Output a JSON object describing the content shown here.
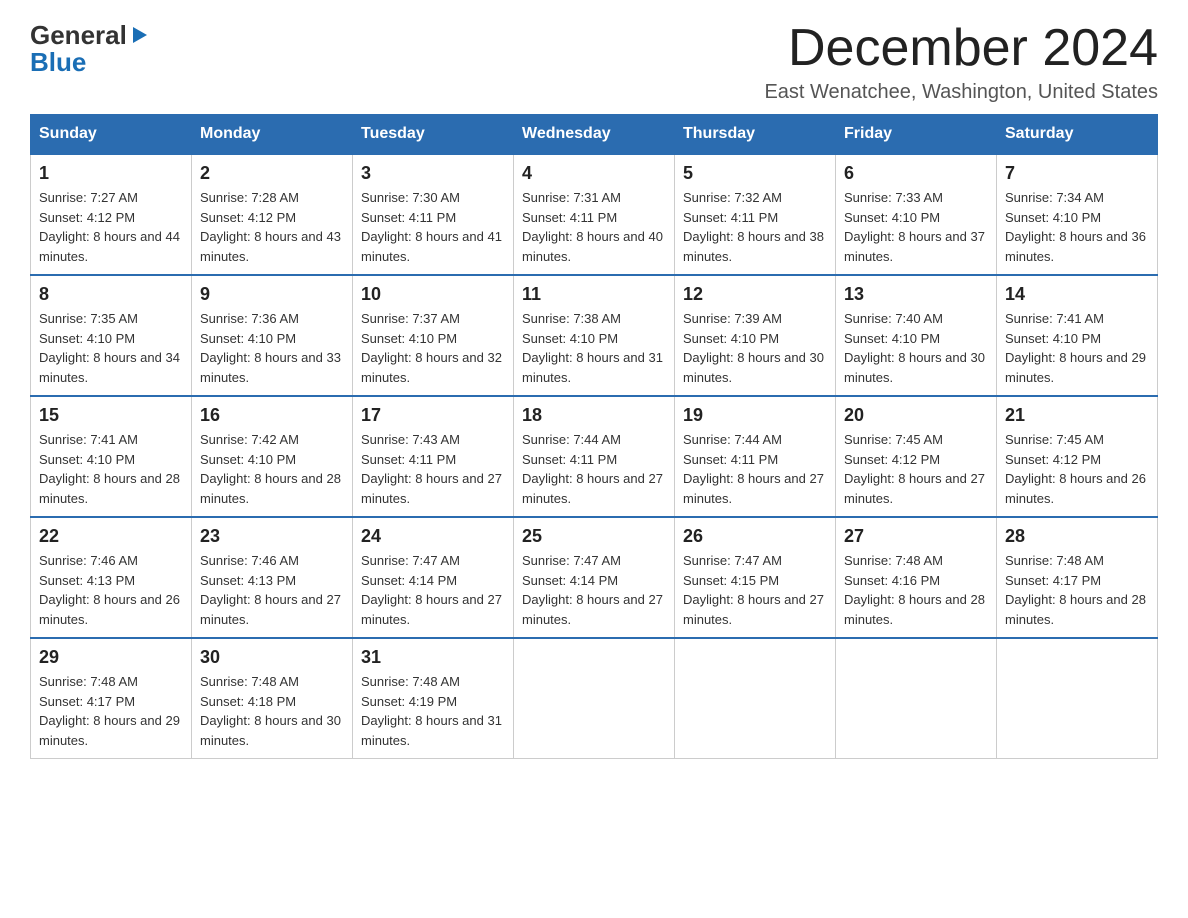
{
  "logo": {
    "line1": "General",
    "line2": "Blue",
    "arrow": "▶"
  },
  "title": "December 2024",
  "subtitle": "East Wenatchee, Washington, United States",
  "weekdays": [
    "Sunday",
    "Monday",
    "Tuesday",
    "Wednesday",
    "Thursday",
    "Friday",
    "Saturday"
  ],
  "weeks": [
    [
      {
        "day": "1",
        "sunrise": "7:27 AM",
        "sunset": "4:12 PM",
        "daylight": "8 hours and 44 minutes."
      },
      {
        "day": "2",
        "sunrise": "7:28 AM",
        "sunset": "4:12 PM",
        "daylight": "8 hours and 43 minutes."
      },
      {
        "day": "3",
        "sunrise": "7:30 AM",
        "sunset": "4:11 PM",
        "daylight": "8 hours and 41 minutes."
      },
      {
        "day": "4",
        "sunrise": "7:31 AM",
        "sunset": "4:11 PM",
        "daylight": "8 hours and 40 minutes."
      },
      {
        "day": "5",
        "sunrise": "7:32 AM",
        "sunset": "4:11 PM",
        "daylight": "8 hours and 38 minutes."
      },
      {
        "day": "6",
        "sunrise": "7:33 AM",
        "sunset": "4:10 PM",
        "daylight": "8 hours and 37 minutes."
      },
      {
        "day": "7",
        "sunrise": "7:34 AM",
        "sunset": "4:10 PM",
        "daylight": "8 hours and 36 minutes."
      }
    ],
    [
      {
        "day": "8",
        "sunrise": "7:35 AM",
        "sunset": "4:10 PM",
        "daylight": "8 hours and 34 minutes."
      },
      {
        "day": "9",
        "sunrise": "7:36 AM",
        "sunset": "4:10 PM",
        "daylight": "8 hours and 33 minutes."
      },
      {
        "day": "10",
        "sunrise": "7:37 AM",
        "sunset": "4:10 PM",
        "daylight": "8 hours and 32 minutes."
      },
      {
        "day": "11",
        "sunrise": "7:38 AM",
        "sunset": "4:10 PM",
        "daylight": "8 hours and 31 minutes."
      },
      {
        "day": "12",
        "sunrise": "7:39 AM",
        "sunset": "4:10 PM",
        "daylight": "8 hours and 30 minutes."
      },
      {
        "day": "13",
        "sunrise": "7:40 AM",
        "sunset": "4:10 PM",
        "daylight": "8 hours and 30 minutes."
      },
      {
        "day": "14",
        "sunrise": "7:41 AM",
        "sunset": "4:10 PM",
        "daylight": "8 hours and 29 minutes."
      }
    ],
    [
      {
        "day": "15",
        "sunrise": "7:41 AM",
        "sunset": "4:10 PM",
        "daylight": "8 hours and 28 minutes."
      },
      {
        "day": "16",
        "sunrise": "7:42 AM",
        "sunset": "4:10 PM",
        "daylight": "8 hours and 28 minutes."
      },
      {
        "day": "17",
        "sunrise": "7:43 AM",
        "sunset": "4:11 PM",
        "daylight": "8 hours and 27 minutes."
      },
      {
        "day": "18",
        "sunrise": "7:44 AM",
        "sunset": "4:11 PM",
        "daylight": "8 hours and 27 minutes."
      },
      {
        "day": "19",
        "sunrise": "7:44 AM",
        "sunset": "4:11 PM",
        "daylight": "8 hours and 27 minutes."
      },
      {
        "day": "20",
        "sunrise": "7:45 AM",
        "sunset": "4:12 PM",
        "daylight": "8 hours and 27 minutes."
      },
      {
        "day": "21",
        "sunrise": "7:45 AM",
        "sunset": "4:12 PM",
        "daylight": "8 hours and 26 minutes."
      }
    ],
    [
      {
        "day": "22",
        "sunrise": "7:46 AM",
        "sunset": "4:13 PM",
        "daylight": "8 hours and 26 minutes."
      },
      {
        "day": "23",
        "sunrise": "7:46 AM",
        "sunset": "4:13 PM",
        "daylight": "8 hours and 27 minutes."
      },
      {
        "day": "24",
        "sunrise": "7:47 AM",
        "sunset": "4:14 PM",
        "daylight": "8 hours and 27 minutes."
      },
      {
        "day": "25",
        "sunrise": "7:47 AM",
        "sunset": "4:14 PM",
        "daylight": "8 hours and 27 minutes."
      },
      {
        "day": "26",
        "sunrise": "7:47 AM",
        "sunset": "4:15 PM",
        "daylight": "8 hours and 27 minutes."
      },
      {
        "day": "27",
        "sunrise": "7:48 AM",
        "sunset": "4:16 PM",
        "daylight": "8 hours and 28 minutes."
      },
      {
        "day": "28",
        "sunrise": "7:48 AM",
        "sunset": "4:17 PM",
        "daylight": "8 hours and 28 minutes."
      }
    ],
    [
      {
        "day": "29",
        "sunrise": "7:48 AM",
        "sunset": "4:17 PM",
        "daylight": "8 hours and 29 minutes."
      },
      {
        "day": "30",
        "sunrise": "7:48 AM",
        "sunset": "4:18 PM",
        "daylight": "8 hours and 30 minutes."
      },
      {
        "day": "31",
        "sunrise": "7:48 AM",
        "sunset": "4:19 PM",
        "daylight": "8 hours and 31 minutes."
      },
      null,
      null,
      null,
      null
    ]
  ],
  "labels": {
    "sunrise": "Sunrise: ",
    "sunset": "Sunset: ",
    "daylight": "Daylight: "
  }
}
